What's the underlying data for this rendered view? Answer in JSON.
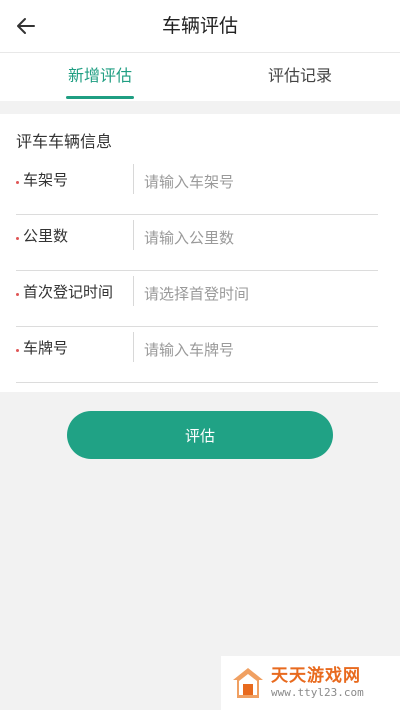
{
  "header": {
    "title": "车辆评估",
    "back_icon": "arrow-left-icon"
  },
  "tabs": [
    {
      "label": "新增评估",
      "active": true
    },
    {
      "label": "评估记录",
      "active": false
    }
  ],
  "form": {
    "section_title": "评车车辆信息",
    "fields": [
      {
        "label": "车架号",
        "placeholder": "请输入车架号",
        "value": ""
      },
      {
        "label": "公里数",
        "placeholder": "请输入公里数",
        "value": ""
      },
      {
        "label": "首次登记时间",
        "placeholder": "请选择首登时间",
        "value": ""
      },
      {
        "label": "车牌号",
        "placeholder": "请输入车牌号",
        "value": ""
      }
    ]
  },
  "actions": {
    "submit_label": "评估"
  },
  "watermark": {
    "title": "天天游戏网",
    "url": "www.ttyl23.com"
  },
  "colors": {
    "accent": "#20a285",
    "required_dot": "#e05555",
    "watermark_orange": "#e86a1e"
  }
}
